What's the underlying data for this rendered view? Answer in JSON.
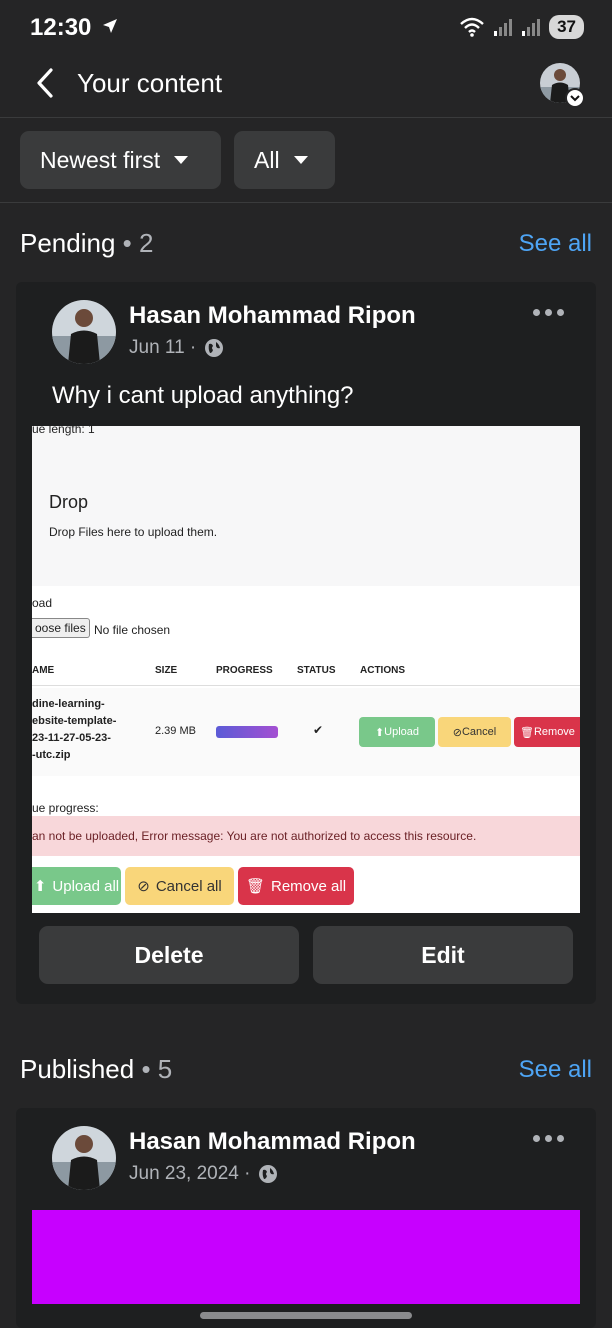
{
  "status": {
    "time": "12:30",
    "battery": "37"
  },
  "header": {
    "title": "Your content"
  },
  "filters": {
    "sort_label": "Newest first",
    "type_label": "All"
  },
  "pending": {
    "title": "Pending",
    "count": "• 2",
    "see_all": "See all",
    "post": {
      "author": "Hasan Mohammad Ripon",
      "date": "Jun 11 ·",
      "text": "Why i cant upload anything?",
      "screenshot": {
        "queue_length": "ue length: 1",
        "drop_title": "Drop",
        "drop_hint": "Drop Files here to upload them.",
        "upload_label": "oad",
        "choose_files": "oose files",
        "no_file": "No file chosen",
        "columns": [
          "AME",
          "SIZE",
          "PROGRESS",
          "STATUS",
          "ACTIONS"
        ],
        "file_name_lines": [
          "dine-learning-",
          "ebsite-template-",
          "23-11-27-05-23-",
          "-utc.zip"
        ],
        "file_size": "2.39 MB",
        "status_mark": "✔",
        "row_buttons": {
          "upload": "Upload",
          "cancel": "Cancel",
          "remove": "Remove"
        },
        "queue_progress": "ue progress:",
        "error": "an not be uploaded, Error message: You are not authorized to access this resource.",
        "bottom_buttons": {
          "upload_all": "Upload all",
          "cancel_all": "Cancel all",
          "remove_all": "Remove all"
        }
      },
      "delete_label": "Delete",
      "edit_label": "Edit"
    }
  },
  "published": {
    "title": "Published",
    "count": "• 5",
    "see_all": "See all",
    "post": {
      "author": "Hasan Mohammad Ripon",
      "date": "Jun 23, 2024 ·"
    }
  },
  "icons": {
    "back": "chevron-left-icon",
    "more": "more-dots-icon",
    "privacy": "globe-icon",
    "sort_caret": "caret-down-icon"
  },
  "colors": {
    "background": "#252526",
    "card": "#1e1f20",
    "button": "#3a3b3c",
    "link": "#4ea5f5",
    "magenta_image": "#c700ff"
  }
}
